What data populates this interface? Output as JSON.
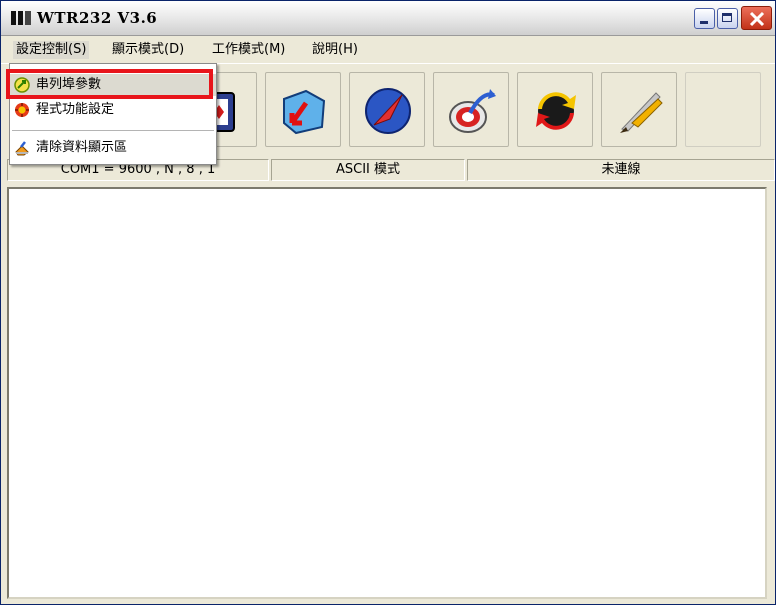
{
  "window": {
    "title": "WTR232  V3.6"
  },
  "menubar": [
    {
      "label": "設定控制(S)"
    },
    {
      "label": "顯示模式(D)"
    },
    {
      "label": "工作模式(M)"
    },
    {
      "label": "說明(H)"
    }
  ],
  "dropdown": {
    "items": [
      {
        "label": "串列埠參數",
        "icon": "serial-port-icon"
      },
      {
        "label": "程式功能設定",
        "icon": "program-settings-icon"
      },
      {
        "label": "清除資料顯示區",
        "icon": "clear-display-icon"
      }
    ]
  },
  "status": {
    "port": "COM1 = 9600 , N , 8 , 1",
    "mode": "ASCII 模式",
    "connection": "未連線"
  },
  "colors": {
    "highlight": "#e8151b",
    "titlebar_border": "#0a246a"
  }
}
